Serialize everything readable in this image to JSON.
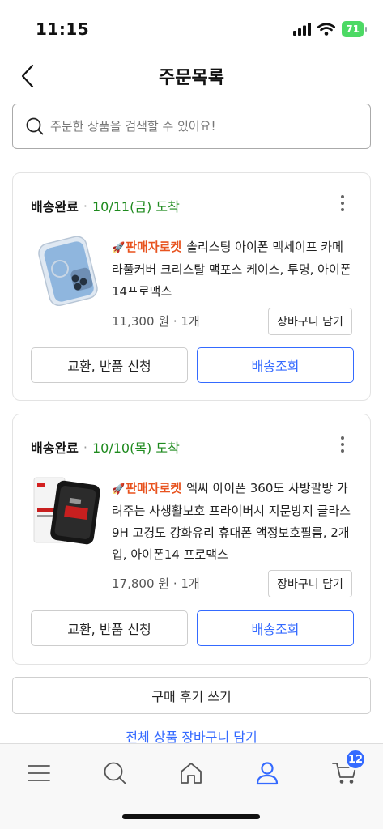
{
  "status_bar": {
    "time": "11:15",
    "battery": "71"
  },
  "header": {
    "title": "주문목록"
  },
  "search": {
    "placeholder": "주문한 상품을 검색할 수 있어요!"
  },
  "orders": [
    {
      "status": "배송완료",
      "date_text": "10/11(금) 도착",
      "rocket_label": "판매자로켓",
      "product_name": "솔리스팅 아이폰 맥세이프 카메라풀커버 크리스탈 맥포스 케이스, 투명, 아이폰14프로맥스",
      "price_qty": "11,300 원 · 1개",
      "cart_label": "장바구니 담기",
      "exchange_label": "교환, 반품 신청",
      "track_label": "배송조회"
    },
    {
      "status": "배송완료",
      "date_text": "10/10(목) 도착",
      "rocket_label": "판매자로켓",
      "product_name": "엑씨 아이폰 360도 사방팔방 가려주는 사생활보호 프라이버시 지문방지 글라스 9H 고경도 강화유리 휴대폰 액정보호필름, 2개입, 아이폰14 프로맥스",
      "price_qty": "17,800 원 · 1개",
      "cart_label": "장바구니 담기",
      "exchange_label": "교환, 반품 신청",
      "track_label": "배송조회"
    }
  ],
  "review_button": "구매 후기 쓰기",
  "cart_all_link": "전체 상품 장바구니 담기",
  "tab_bar": {
    "items": [
      "menu-icon",
      "search-icon",
      "home-icon",
      "profile-icon",
      "cart-icon"
    ],
    "cart_count": "12",
    "active_color": "#346aff"
  },
  "colors": {
    "accent": "#346aff",
    "delivered": "#1e8a1e",
    "rocket": "#e8531f"
  }
}
